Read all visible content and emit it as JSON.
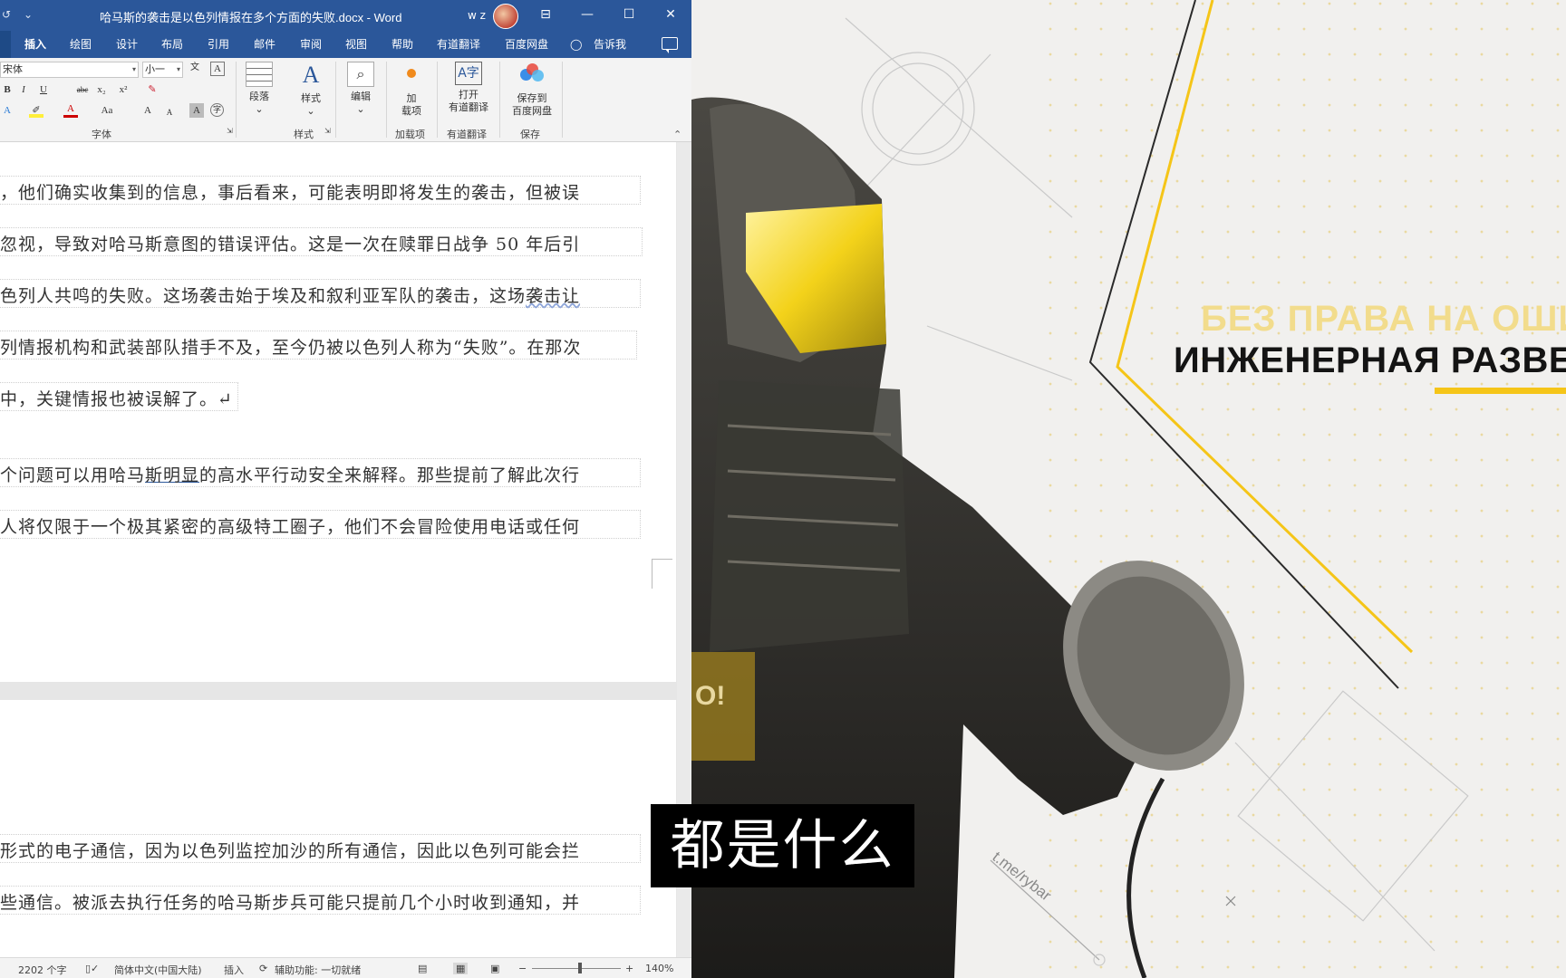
{
  "window": {
    "title": "哈马斯的袭击是以色列情报在多个方面的失败.docx  -  Word",
    "user": "w z",
    "buttons": {
      "ribbon_display": "⊟",
      "minimize": "—",
      "maximize": "☐",
      "close": "✕"
    }
  },
  "menu": {
    "tabs": [
      "插入",
      "绘图",
      "设计",
      "布局",
      "引用",
      "邮件",
      "审阅",
      "视图",
      "帮助",
      "有道翻译",
      "百度网盘"
    ],
    "tell_me": "告诉我"
  },
  "ribbon": {
    "font_name": "宋体",
    "font_size": "小一",
    "wen_label": "文",
    "font_buttons": {
      "bold": "B",
      "italic": "I",
      "underline": "U",
      "strike": "abc",
      "subscript": "x₂",
      "superscript": "x²",
      "grow": "A",
      "shrink": "A",
      "case": "Aa"
    },
    "groups": {
      "font": "字体",
      "styles": "样式",
      "addins": "加载项",
      "youdao": "有道翻译",
      "save": "保存"
    },
    "buttons": {
      "paragraph": "段落",
      "styles": "样式",
      "edit": "编辑",
      "addin_line1": "加",
      "addin_line2": "载项",
      "youdao_line1": "打开",
      "youdao_line2": "有道翻译",
      "baidu_line1": "保存到",
      "baidu_line2": "百度网盘"
    }
  },
  "document": {
    "p1": [
      "，他们确实收集到的信息，事后看来，可能表明即将发生的袭击，但被误",
      "忽视，导致对哈马斯意图的错误评估。这是一次在赎罪日战争 50 年后引",
      "色列人共鸣的失败。这场袭击始于埃及和叙利亚军队的袭击，这场",
      "列情报机构和武装部队措手不及，至今仍被以色列人称为“失败”。在那次",
      "中，关键情报也被误解了。↵"
    ],
    "p1_l3_tail": "袭击让",
    "p2": [
      "个问题可以用哈马",
      "人将仅限于一个极其紧密的高级特工圈子，他们不会冒险使用电话或任何"
    ],
    "p2_l1_link": "斯明显",
    "p2_l1_rest": "的高水平行动安全来解释。那些提前了解此次行",
    "p3": [
      "形式的电子通信，因为以色列监控加沙的所有通信，因此以色列可能会拦",
      "些通信。被派去执行任务的哈马斯步兵可能只提前几个小时收到通知，并"
    ]
  },
  "status": {
    "word_count": "2202 个字",
    "language": "简体中文(中国大陆)",
    "mode": "插入",
    "accessibility": "辅助功能: 一切就绪",
    "zoom": "140%"
  },
  "poster": {
    "line1": "БЕЗ ПРАВА НА ОШИБ",
    "line2": "ИНЖЕНЕРНАЯ РАЗВЕД",
    "handle": "t.me/rybar",
    "badge": "O!",
    "colors": {
      "accent": "#f5c518",
      "frame": "#2a2a2a"
    }
  },
  "subtitle": "都是什么"
}
